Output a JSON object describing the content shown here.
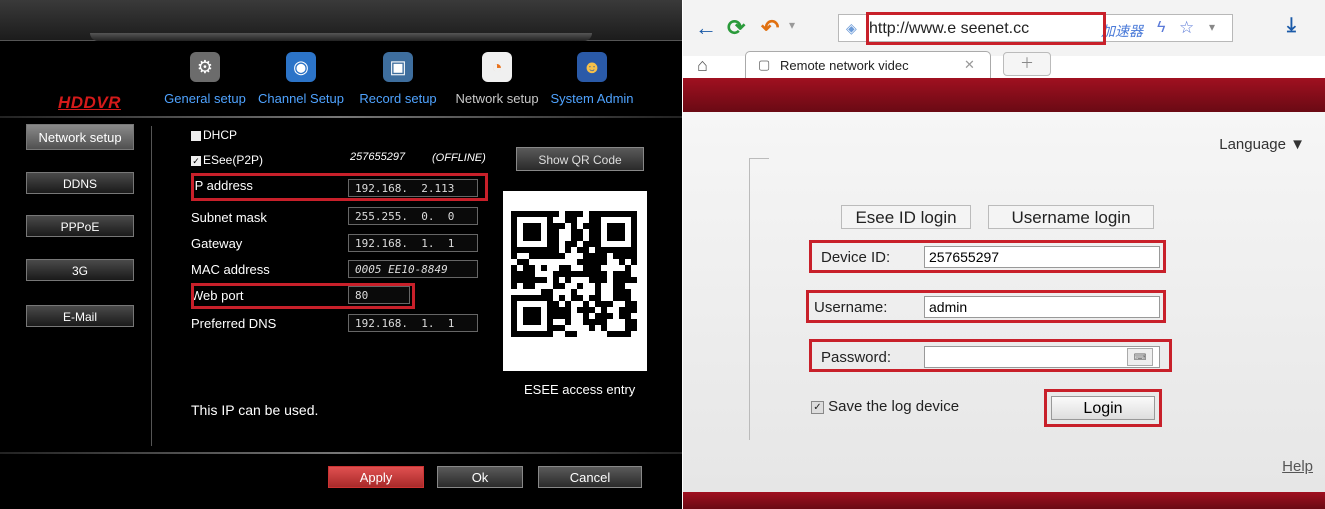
{
  "dvr": {
    "brand": "HDDVR",
    "nav": [
      {
        "label": "General setup",
        "icon": "gear-icon"
      },
      {
        "label": "Channel Setup",
        "icon": "camera-icon"
      },
      {
        "label": "Record setup",
        "icon": "record-icon"
      },
      {
        "label": "Network setup",
        "icon": "wifi-icon"
      },
      {
        "label": "System Admin",
        "icon": "users-icon"
      }
    ],
    "sidebar": [
      "Network setup",
      "DDNS",
      "PPPoE",
      "3G",
      "E-Mail"
    ],
    "dhcp_label": "DHCP",
    "esee_label": "ESee(P2P)",
    "esee_id": "257655297",
    "esee_status": "(OFFLINE)",
    "show_qr_label": "Show QR Code",
    "fields": {
      "ip_label": "IP address",
      "ip_value": "192.168.  2.113",
      "subnet_label": "Subnet mask",
      "subnet_value": "255.255.  0.  0",
      "gateway_label": "Gateway",
      "gateway_value": "192.168.  1.  1",
      "mac_label": "MAC address",
      "mac_value": "0005 EE10-8849",
      "webport_label": "Web port",
      "webport_value": "80",
      "dns_label": "Preferred DNS",
      "dns_value": "192.168.  1.  1"
    },
    "qr_caption": "ESEE access entry",
    "status_msg": "This IP can be used.",
    "buttons": {
      "apply": "Apply",
      "ok": "Ok",
      "cancel": "Cancel"
    }
  },
  "browser": {
    "url": "http://www.e seenet.cc",
    "accelerator": "加速器",
    "tab_title": "Remote network videc",
    "language_label": "Language ▼",
    "esee_login_tab": "Esee ID login",
    "username_login_tab": "Username login",
    "device_id_label": "Device ID:",
    "device_id_value": "257655297",
    "username_label": "Username:",
    "username_value": "admin",
    "password_label": "Password:",
    "password_value": "",
    "save_label": "Save the log device",
    "login_label": "Login",
    "help_label": "Help"
  },
  "colors": {
    "highlight": "#c8202a",
    "brand": "#d41a1a",
    "browser_bar": "#8a1020"
  }
}
